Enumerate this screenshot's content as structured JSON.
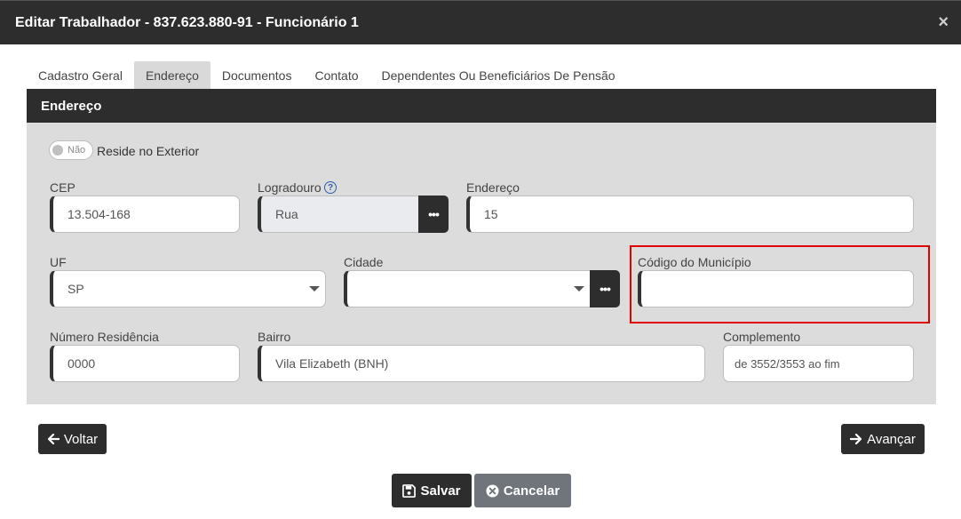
{
  "modal": {
    "title": "Editar Trabalhador - 837.623.880-91 - Funcionário 1",
    "close_label": "×"
  },
  "tabs": [
    {
      "label": "Cadastro Geral",
      "active": false
    },
    {
      "label": "Endereço",
      "active": true
    },
    {
      "label": "Documentos",
      "active": false
    },
    {
      "label": "Contato",
      "active": false
    },
    {
      "label": "Dependentes Ou Beneficiários De Pensão",
      "active": false
    }
  ],
  "section": {
    "title": "Endereço"
  },
  "exterior": {
    "toggle_text": "Não",
    "label": "Reside no Exterior"
  },
  "fields": {
    "cep": {
      "label": "CEP",
      "value": "13.504-168"
    },
    "logradouro": {
      "label": "Logradouro",
      "value": "Rua",
      "help": "?"
    },
    "endereco": {
      "label": "Endereço",
      "value": "15"
    },
    "uf": {
      "label": "UF",
      "value": "SP"
    },
    "cidade": {
      "label": "Cidade",
      "value": ""
    },
    "codigo_municipio": {
      "label": "Código do Município",
      "value": ""
    },
    "numero": {
      "label": "Número Residência",
      "value": "0000"
    },
    "bairro": {
      "label": "Bairro",
      "value": "Vila Elizabeth (BNH)"
    },
    "complemento": {
      "label": "Complemento",
      "value": "de 3552/3553 ao fim"
    }
  },
  "dots_label": "•••",
  "buttons": {
    "voltar": "Voltar",
    "avancar": "Avançar",
    "salvar": "Salvar",
    "cancelar": "Cancelar"
  },
  "colors": {
    "header": "#2d2d2d",
    "section_bg": "#dcdcdc",
    "highlight": "#e00000",
    "cancel": "#6f757b"
  }
}
